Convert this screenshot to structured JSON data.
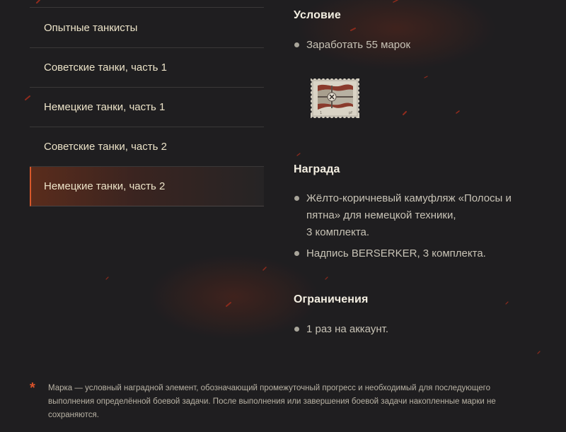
{
  "sidebar": {
    "items": [
      {
        "label": "Опытные танкисты",
        "active": false
      },
      {
        "label": "Советские танки, часть 1",
        "active": false
      },
      {
        "label": "Немецкие танки, часть 1",
        "active": false
      },
      {
        "label": "Советские танки, часть 2",
        "active": false
      },
      {
        "label": "Немецкие танки, часть 2",
        "active": true
      }
    ]
  },
  "condition": {
    "title": "Условие",
    "items": [
      "Заработать 55 марок"
    ],
    "stamp_icon": "german-flag-stamp-icon"
  },
  "reward": {
    "title": "Награда",
    "items": [
      {
        "lines": [
          "Жёлто-коричневый камуфляж «Полосы и",
          "пятна» для немецкой техники,",
          "3 комплекта."
        ]
      },
      {
        "lines": [
          "Надпись BERSERKER, 3 комплекта."
        ]
      }
    ]
  },
  "limits": {
    "title": "Ограничения",
    "items": [
      "1 раз на аккаунт."
    ]
  },
  "footnote": {
    "marker": "*",
    "lines": [
      "Марка — условный наградной элемент, обозначающий промежуточный прогресс и необходимый для последующего",
      "выполнения определённой боевой задачи. После выполнения или завершения боевой задачи накопленные марки не",
      "сохраняются."
    ]
  },
  "colors": {
    "background": "#1f1e20",
    "accent": "#d8582a",
    "heading": "#f4efe2",
    "text": "#c8c3b6"
  }
}
